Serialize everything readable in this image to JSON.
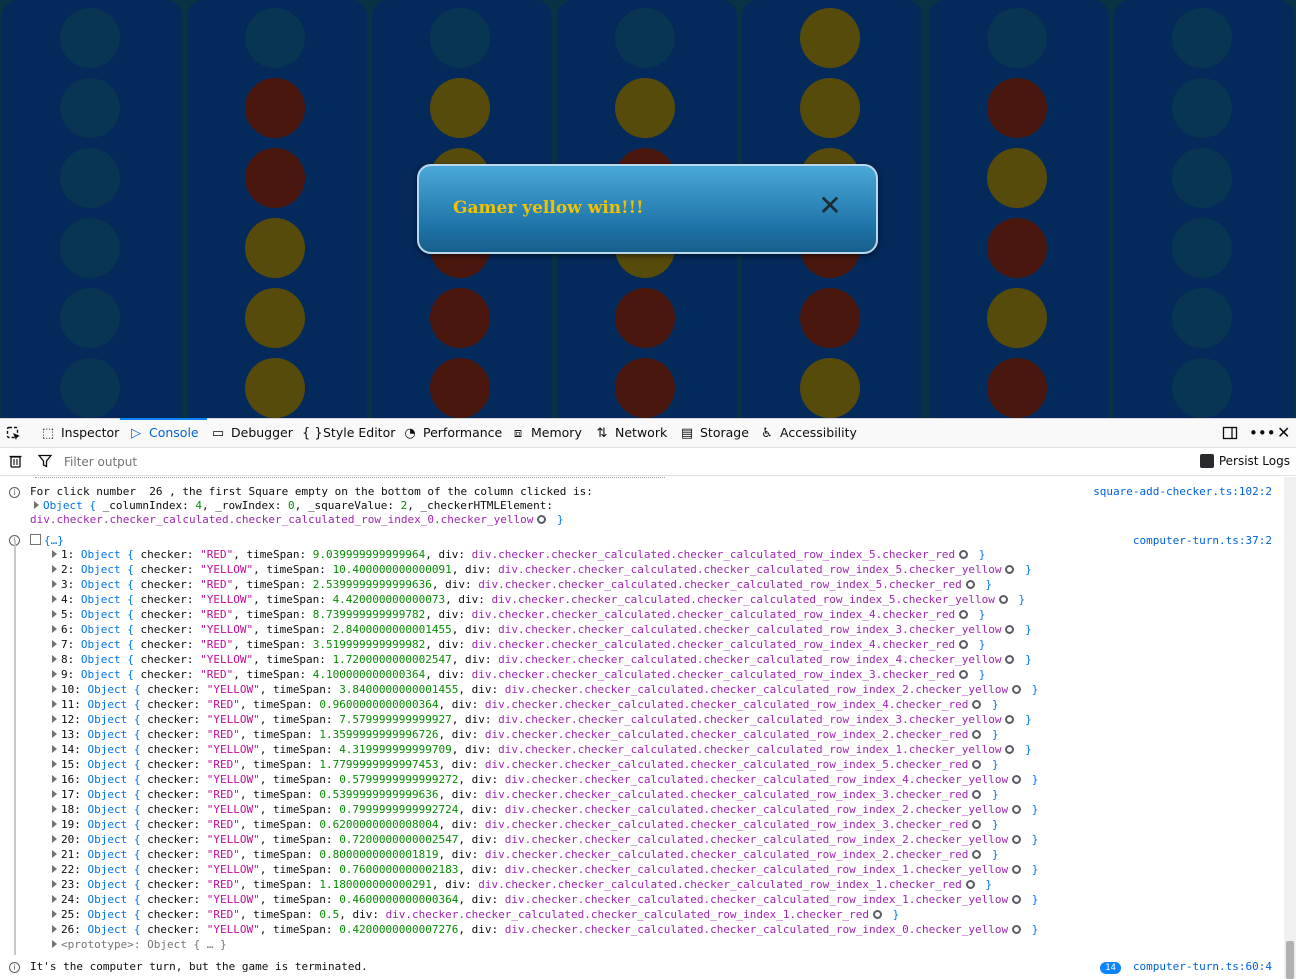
{
  "game": {
    "columns": [
      [
        "empty",
        "empty",
        "empty",
        "empty",
        "empty",
        "empty"
      ],
      [
        "empty",
        "red",
        "red",
        "yellow",
        "yellow",
        "yellow"
      ],
      [
        "empty",
        "yellow",
        "yellow",
        "red",
        "red",
        "red"
      ],
      [
        "empty",
        "yellow",
        "red",
        "yellow",
        "red",
        "red"
      ],
      [
        "yellow",
        "yellow",
        "yellow",
        "red",
        "red",
        "yellow"
      ],
      [
        "empty",
        "red",
        "yellow",
        "red",
        "yellow",
        "red"
      ],
      [
        "empty",
        "empty",
        "empty",
        "empty",
        "empty",
        "empty"
      ]
    ],
    "colors": {
      "board": "#06306a",
      "red": "#5a1a0a",
      "yellow": "#6b5a08",
      "empty": "#0a3f5e"
    },
    "modal": {
      "message": "Gamer yellow win!!!",
      "close_glyph": "✕"
    }
  },
  "devtools": {
    "tabs": [
      {
        "label": "Inspector",
        "icon": "inspector-icon"
      },
      {
        "label": "Console",
        "icon": "console-icon",
        "selected": true
      },
      {
        "label": "Debugger",
        "icon": "debugger-icon"
      },
      {
        "label": "Style Editor",
        "icon": "style-editor-icon"
      },
      {
        "label": "Performance",
        "icon": "performance-icon"
      },
      {
        "label": "Memory",
        "icon": "memory-icon"
      },
      {
        "label": "Network",
        "icon": "network-icon"
      },
      {
        "label": "Storage",
        "icon": "storage-icon"
      },
      {
        "label": "Accessibility",
        "icon": "accessibility-icon"
      }
    ],
    "filter_placeholder": "Filter output",
    "persist_logs": "Persist Logs"
  },
  "console": {
    "msg1": {
      "text": "For click number  26 , the first Square empty on the bottom of the column clicked is:",
      "source": "square-add-checker.ts:102:2",
      "obj_line1_a": "Object { ",
      "obj_line1_b": "_columnIndex: ",
      "obj_line1_c": "4",
      "obj_line1_d": ", _rowIndex: ",
      "obj_line1_e": "0",
      "obj_line1_f": ", _squareValue: ",
      "obj_line1_g": "2",
      "obj_line1_h": ", _checkerHTMLElement:",
      "obj_line2": "div.checker.checker_calculated.checker_calculated_row_index_0.checker_yellow",
      "obj_close": "}"
    },
    "group": {
      "label": "{…}",
      "source": "computer-turn.ts:37:2",
      "entries": [
        [
          "1",
          "RED",
          "9.039999999999964",
          "div.checker.checker_calculated.checker_calculated_row_index_5.checker_red"
        ],
        [
          "2",
          "YELLOW",
          "10.400000000000091",
          "div.checker.checker_calculated.checker_calculated_row_index_5.checker_yellow"
        ],
        [
          "3",
          "RED",
          "2.5399999999999636",
          "div.checker.checker_calculated.checker_calculated_row_index_5.checker_red"
        ],
        [
          "4",
          "YELLOW",
          "4.420000000000073",
          "div.checker.checker_calculated.checker_calculated_row_index_5.checker_yellow"
        ],
        [
          "5",
          "RED",
          "8.739999999999782",
          "div.checker.checker_calculated.checker_calculated_row_index_4.checker_red"
        ],
        [
          "6",
          "YELLOW",
          "2.8400000000001455",
          "div.checker.checker_calculated.checker_calculated_row_index_3.checker_yellow"
        ],
        [
          "7",
          "RED",
          "3.519999999999982",
          "div.checker.checker_calculated.checker_calculated_row_index_4.checker_red"
        ],
        [
          "8",
          "YELLOW",
          "1.7200000000002547",
          "div.checker.checker_calculated.checker_calculated_row_index_4.checker_yellow"
        ],
        [
          "9",
          "RED",
          "4.100000000000364",
          "div.checker.checker_calculated.checker_calculated_row_index_3.checker_red"
        ],
        [
          "10",
          "YELLOW",
          "3.8400000000001455",
          "div.checker.checker_calculated.checker_calculated_row_index_2.checker_yellow"
        ],
        [
          "11",
          "RED",
          "0.9600000000000364",
          "div.checker.checker_calculated.checker_calculated_row_index_4.checker_red"
        ],
        [
          "12",
          "YELLOW",
          "7.579999999999927",
          "div.checker.checker_calculated.checker_calculated_row_index_3.checker_yellow"
        ],
        [
          "13",
          "RED",
          "1.3599999999996726",
          "div.checker.checker_calculated.checker_calculated_row_index_2.checker_red"
        ],
        [
          "14",
          "YELLOW",
          "4.319999999999709",
          "div.checker.checker_calculated.checker_calculated_row_index_1.checker_yellow"
        ],
        [
          "15",
          "RED",
          "1.7799999999997453",
          "div.checker.checker_calculated.checker_calculated_row_index_5.checker_red"
        ],
        [
          "16",
          "YELLOW",
          "0.5799999999999272",
          "div.checker.checker_calculated.checker_calculated_row_index_4.checker_yellow"
        ],
        [
          "17",
          "RED",
          "0.5399999999999636",
          "div.checker.checker_calculated.checker_calculated_row_index_3.checker_red"
        ],
        [
          "18",
          "YELLOW",
          "0.7999999999992724",
          "div.checker.checker_calculated.checker_calculated_row_index_2.checker_yellow"
        ],
        [
          "19",
          "RED",
          "0.6200000000008004",
          "div.checker.checker_calculated.checker_calculated_row_index_3.checker_red"
        ],
        [
          "20",
          "YELLOW",
          "0.7200000000002547",
          "div.checker.checker_calculated.checker_calculated_row_index_2.checker_yellow"
        ],
        [
          "21",
          "RED",
          "0.8000000000001819",
          "div.checker.checker_calculated.checker_calculated_row_index_2.checker_red"
        ],
        [
          "22",
          "YELLOW",
          "0.7600000000002183",
          "div.checker.checker_calculated.checker_calculated_row_index_1.checker_yellow"
        ],
        [
          "23",
          "RED",
          "1.180000000000291",
          "div.checker.checker_calculated.checker_calculated_row_index_1.checker_red"
        ],
        [
          "24",
          "YELLOW",
          "0.4600000000000364",
          "div.checker.checker_calculated.checker_calculated_row_index_1.checker_yellow"
        ],
        [
          "25",
          "RED",
          "0.5",
          "div.checker.checker_calculated.checker_calculated_row_index_1.checker_red"
        ],
        [
          "26",
          "YELLOW",
          "0.4200000000007276",
          "div.checker.checker_calculated.checker_calculated_row_index_0.checker_yellow"
        ]
      ],
      "prototype": "<prototype>: Object { … }"
    },
    "msg3": {
      "text": "It's the computer turn, but the game is terminated.",
      "count": "14",
      "source": "computer-turn.ts:60:4"
    }
  }
}
